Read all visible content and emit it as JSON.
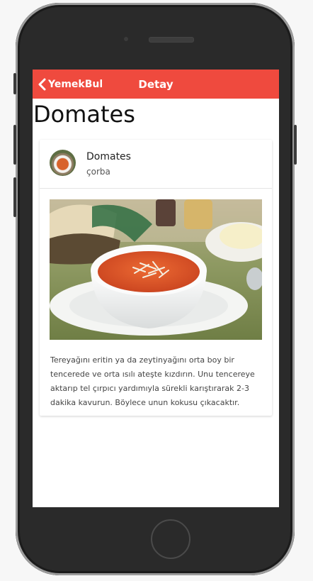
{
  "nav": {
    "back_label": "YemekBul",
    "title": "Detay"
  },
  "page": {
    "title": "Domates"
  },
  "card": {
    "title": "Domates",
    "subtitle": "çorba",
    "description": "Tereyağını eritin ya da zeytinyağını orta boy bir tencerede ve orta ısılı ateşte kızdırın. Unu tencereye aktarıp tel çırpıcı yardımıyla sürekli karıştırarak 2-3 dakika kavurun. Böylece unun kokusu çıkacaktır."
  },
  "colors": {
    "navbar": "#ef4a3e",
    "phone_body": "#2a2a2a",
    "soup": "#d9552a"
  },
  "icons": {
    "back": "chevron-left-icon"
  }
}
